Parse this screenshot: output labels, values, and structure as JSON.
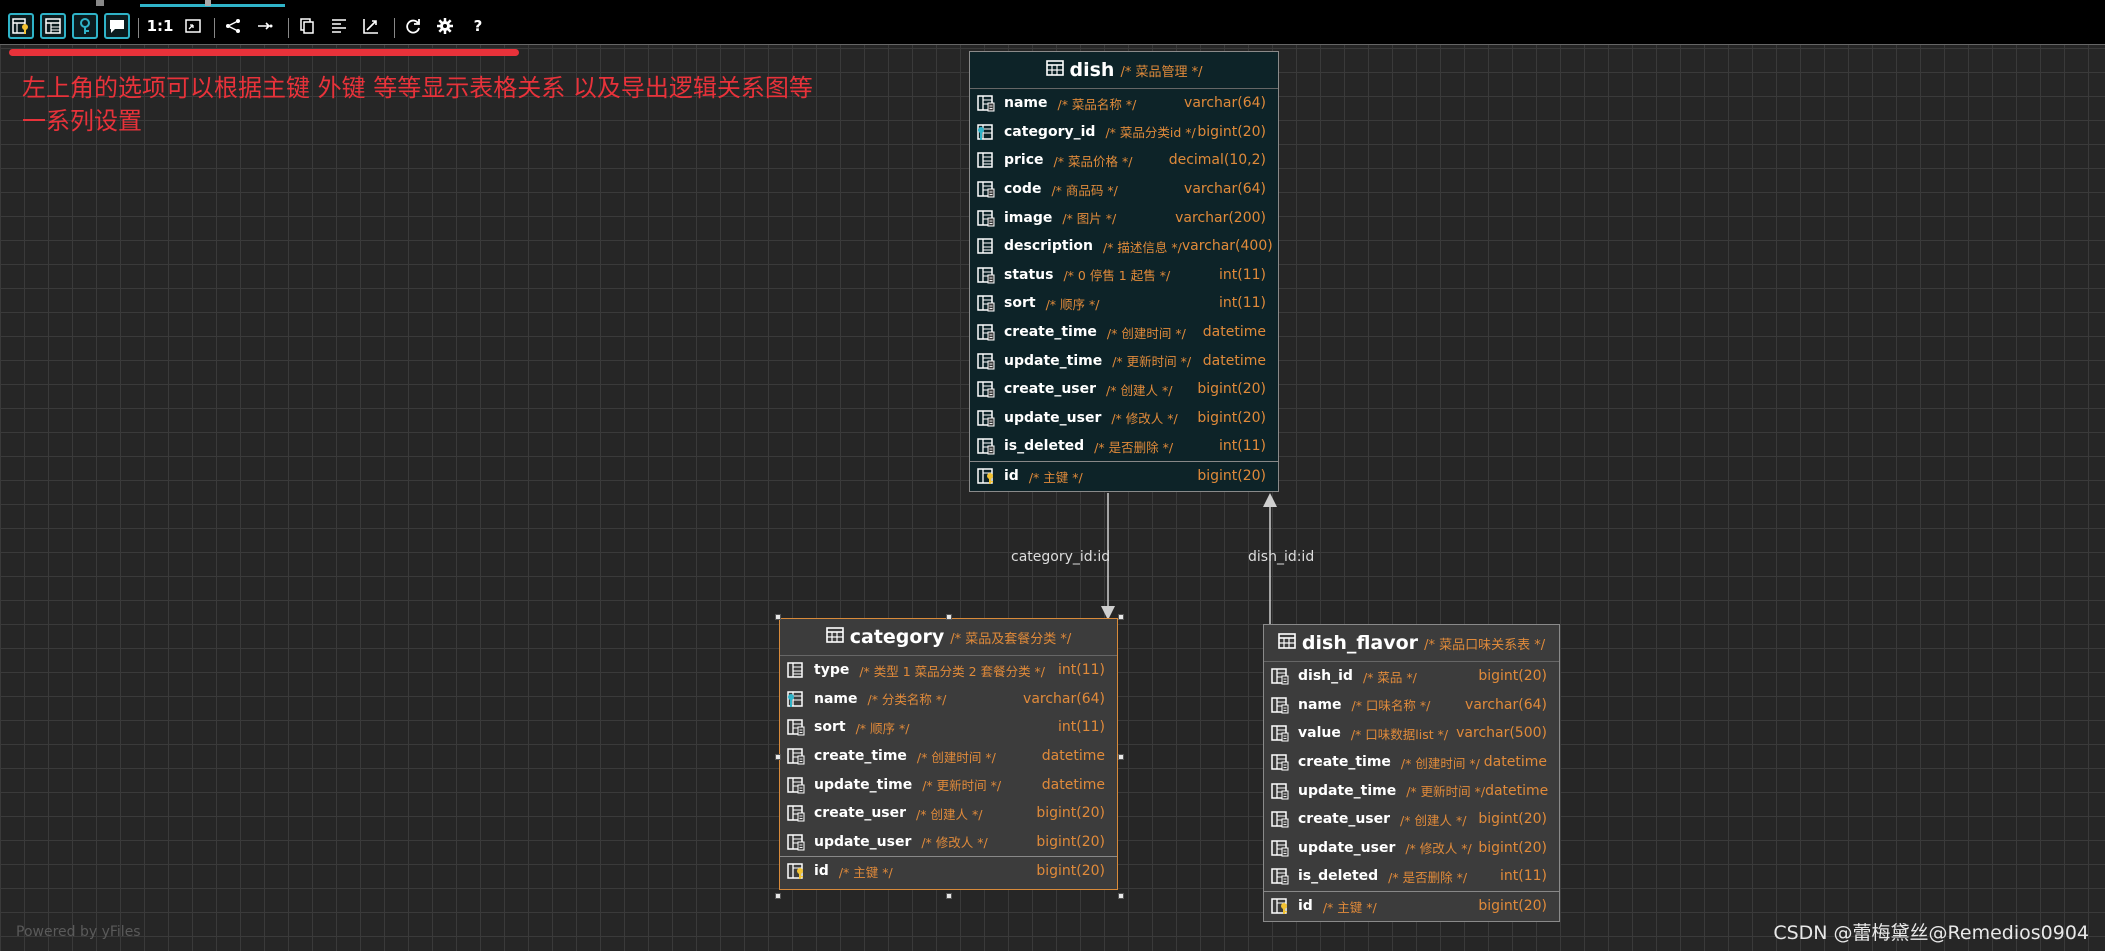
{
  "toolbar": {
    "buttons": [
      {
        "name": "show-keys-icon",
        "active": true
      },
      {
        "name": "show-columns-icon",
        "active": true
      },
      {
        "name": "show-primary-key-icon",
        "active": true
      },
      {
        "name": "show-comments-icon",
        "active": true
      },
      {
        "name": "actual-size-label",
        "text": "1:1"
      },
      {
        "name": "fit-content-icon"
      },
      {
        "name": "layout-icon"
      },
      {
        "name": "show-edges-icon"
      },
      {
        "name": "copy-icon"
      },
      {
        "name": "align-icon"
      },
      {
        "name": "export-icon"
      },
      {
        "name": "refresh-icon"
      },
      {
        "name": "settings-icon"
      },
      {
        "name": "help-label",
        "text": "?"
      }
    ]
  },
  "annotation": {
    "line1": "左上角的选项可以根据主键 外键 等等显示表格关系 以及导出逻辑关系图等",
    "line2": "一系列设置"
  },
  "tables": {
    "dish": {
      "name": "dish",
      "comment": "/* 菜品管理 */",
      "columns": [
        {
          "name": "name",
          "comment": "/* 菜品名称 */",
          "type": "varchar(64)",
          "key": "index"
        },
        {
          "name": "category_id",
          "comment": "/* 菜品分类id */",
          "type": "bigint(20)",
          "key": "fk"
        },
        {
          "name": "price",
          "comment": "/* 菜品价格 */",
          "type": "decimal(10,2)",
          "key": "col"
        },
        {
          "name": "code",
          "comment": "/* 商品码 */",
          "type": "varchar(64)",
          "key": "index"
        },
        {
          "name": "image",
          "comment": "/* 图片 */",
          "type": "varchar(200)",
          "key": "index"
        },
        {
          "name": "description",
          "comment": "/* 描述信息 */",
          "type": "varchar(400)",
          "key": "col"
        },
        {
          "name": "status",
          "comment": "/* 0 停售 1 起售 */",
          "type": "int(11)",
          "key": "index"
        },
        {
          "name": "sort",
          "comment": "/* 顺序 */",
          "type": "int(11)",
          "key": "index"
        },
        {
          "name": "create_time",
          "comment": "/* 创建时间 */",
          "type": "datetime",
          "key": "index"
        },
        {
          "name": "update_time",
          "comment": "/* 更新时间 */",
          "type": "datetime",
          "key": "index"
        },
        {
          "name": "create_user",
          "comment": "/* 创建人 */",
          "type": "bigint(20)",
          "key": "index"
        },
        {
          "name": "update_user",
          "comment": "/* 修改人 */",
          "type": "bigint(20)",
          "key": "index"
        },
        {
          "name": "is_deleted",
          "comment": "/* 是否删除 */",
          "type": "int(11)",
          "key": "index"
        }
      ],
      "pk": {
        "name": "id",
        "comment": "/* 主键 */",
        "type": "bigint(20)"
      }
    },
    "category": {
      "name": "category",
      "comment": "/* 菜品及套餐分类 */",
      "columns": [
        {
          "name": "type",
          "comment": "/* 类型   1 菜品分类 2 套餐分类 */",
          "type": "int(11)",
          "key": "col"
        },
        {
          "name": "name",
          "comment": "/* 分类名称 */",
          "type": "varchar(64)",
          "key": "fk"
        },
        {
          "name": "sort",
          "comment": "/* 顺序 */",
          "type": "int(11)",
          "key": "index"
        },
        {
          "name": "create_time",
          "comment": "/* 创建时间 */",
          "type": "datetime",
          "key": "index"
        },
        {
          "name": "update_time",
          "comment": "/* 更新时间 */",
          "type": "datetime",
          "key": "index"
        },
        {
          "name": "create_user",
          "comment": "/* 创建人 */",
          "type": "bigint(20)",
          "key": "index"
        },
        {
          "name": "update_user",
          "comment": "/* 修改人 */",
          "type": "bigint(20)",
          "key": "index"
        }
      ],
      "pk": {
        "name": "id",
        "comment": "/* 主键 */",
        "type": "bigint(20)"
      }
    },
    "dish_flavor": {
      "name": "dish_flavor",
      "comment": "/* 菜品口味关系表 */",
      "columns": [
        {
          "name": "dish_id",
          "comment": "/* 菜品 */",
          "type": "bigint(20)",
          "key": "index"
        },
        {
          "name": "name",
          "comment": "/* 口味名称 */",
          "type": "varchar(64)",
          "key": "index"
        },
        {
          "name": "value",
          "comment": "/* 口味数据list */",
          "type": "varchar(500)",
          "key": "index"
        },
        {
          "name": "create_time",
          "comment": "/* 创建时间 */",
          "type": "datetime",
          "key": "index"
        },
        {
          "name": "update_time",
          "comment": "/* 更新时间 */",
          "type": "datetime",
          "key": "index"
        },
        {
          "name": "create_user",
          "comment": "/* 创建人 */",
          "type": "bigint(20)",
          "key": "index"
        },
        {
          "name": "update_user",
          "comment": "/* 修改人 */",
          "type": "bigint(20)",
          "key": "index"
        },
        {
          "name": "is_deleted",
          "comment": "/* 是否删除 */",
          "type": "int(11)",
          "key": "index"
        }
      ],
      "pk": {
        "name": "id",
        "comment": "/* 主键 */",
        "type": "bigint(20)"
      }
    }
  },
  "relations": {
    "category_label": "category_id:id",
    "dish_flavor_label": "dish_id:id"
  },
  "footer": {
    "powered_by": "Powered by yFiles",
    "watermark": "CSDN @蕾梅黛丝@Remedios0904"
  },
  "colors": {
    "accent": "#2fb3c8",
    "annotation": "#e8323a",
    "comment": "#e08a3a",
    "selected_border": "#d88a3a"
  }
}
